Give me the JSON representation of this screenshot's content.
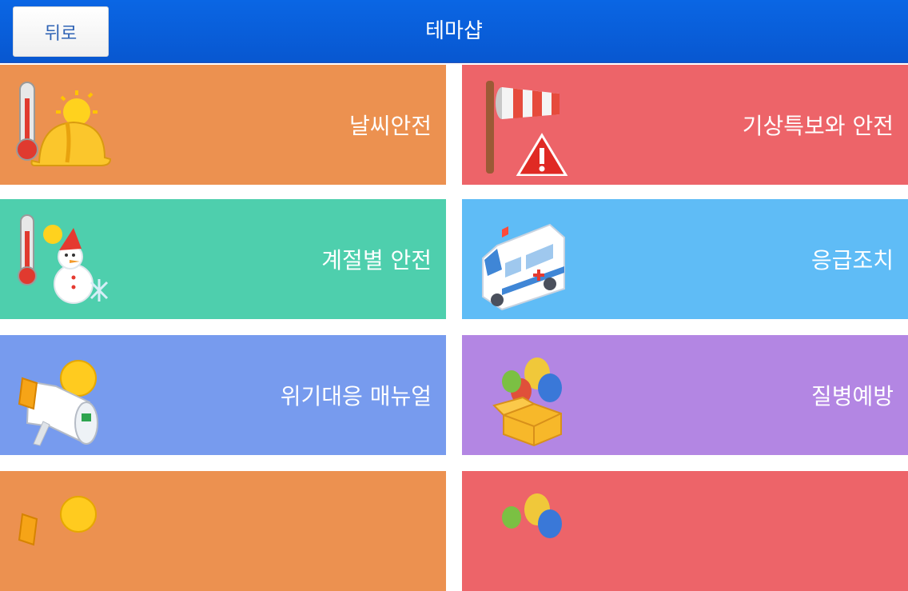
{
  "header": {
    "back_label": "뒤로",
    "title": "테마샵"
  },
  "tiles": [
    {
      "label": "날씨안전",
      "icon": "weather-safety-icon",
      "color": "#ec9150"
    },
    {
      "label": "기상특보와 안전",
      "icon": "windsock-warning-icon",
      "color": "#ed6469"
    },
    {
      "label": "계절별 안전",
      "icon": "seasonal-snowman-icon",
      "color": "#4ecfad"
    },
    {
      "label": "응급조치",
      "icon": "ambulance-icon",
      "color": "#5fbcf6"
    },
    {
      "label": "위기대응 매뉴얼",
      "icon": "megaphone-icon",
      "color": "#779bee"
    },
    {
      "label": "질병예방",
      "icon": "balloons-box-icon",
      "color": "#b386e3"
    },
    {
      "label": "",
      "icon": "megaphone-icon",
      "color": "#ec9150"
    },
    {
      "label": "",
      "icon": "balloons-box-icon",
      "color": "#ed6469"
    }
  ]
}
